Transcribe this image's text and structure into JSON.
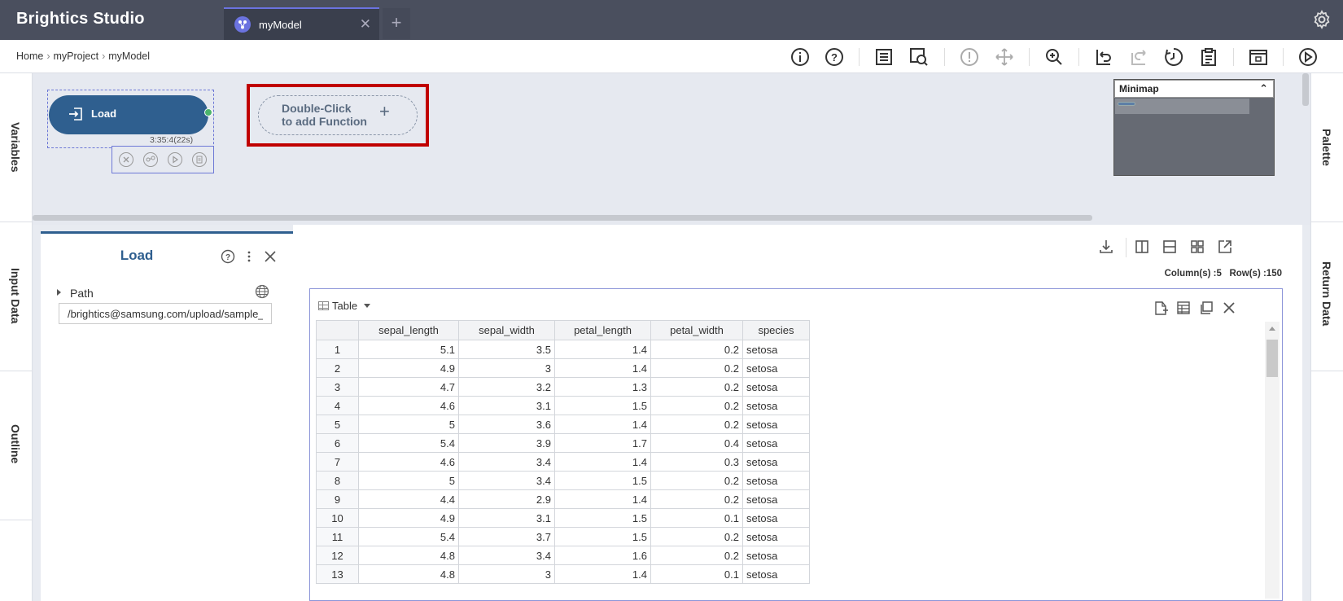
{
  "app": {
    "title": "Brightics Studio"
  },
  "tabs": [
    {
      "label": "myModel"
    }
  ],
  "breadcrumb": {
    "items": [
      "Home",
      "myProject",
      "myModel"
    ]
  },
  "left_rail": {
    "items": [
      "Variables",
      "Input Data",
      "Outline"
    ]
  },
  "right_rail": {
    "items": [
      "Palette",
      "Return Data"
    ]
  },
  "canvas": {
    "node": {
      "label": "Load",
      "time": "3:35:4(22s)"
    },
    "add_function": {
      "line1": "Double-Click",
      "line2": "to add Function",
      "plus": "+"
    },
    "minimap": {
      "title": "Minimap"
    }
  },
  "properties": {
    "title": "Load",
    "path_label": "Path",
    "path_value": "/brightics@samsung.com/upload/sample_iris.csv"
  },
  "result": {
    "counts": "Column(s) :5   Row(s) :150",
    "table_label": "Table",
    "columns": [
      "sepal_length",
      "sepal_width",
      "petal_length",
      "petal_width",
      "species"
    ],
    "rows": [
      [
        "1",
        "5.1",
        "3.5",
        "1.4",
        "0.2",
        "setosa"
      ],
      [
        "2",
        "4.9",
        "3",
        "1.4",
        "0.2",
        "setosa"
      ],
      [
        "3",
        "4.7",
        "3.2",
        "1.3",
        "0.2",
        "setosa"
      ],
      [
        "4",
        "4.6",
        "3.1",
        "1.5",
        "0.2",
        "setosa"
      ],
      [
        "5",
        "5",
        "3.6",
        "1.4",
        "0.2",
        "setosa"
      ],
      [
        "6",
        "5.4",
        "3.9",
        "1.7",
        "0.4",
        "setosa"
      ],
      [
        "7",
        "4.6",
        "3.4",
        "1.4",
        "0.3",
        "setosa"
      ],
      [
        "8",
        "5",
        "3.4",
        "1.5",
        "0.2",
        "setosa"
      ],
      [
        "9",
        "4.4",
        "2.9",
        "1.4",
        "0.2",
        "setosa"
      ],
      [
        "10",
        "4.9",
        "3.1",
        "1.5",
        "0.1",
        "setosa"
      ],
      [
        "11",
        "5.4",
        "3.7",
        "1.5",
        "0.2",
        "setosa"
      ],
      [
        "12",
        "4.8",
        "3.4",
        "1.6",
        "0.2",
        "setosa"
      ],
      [
        "13",
        "4.8",
        "3",
        "1.4",
        "0.1",
        "setosa"
      ]
    ]
  },
  "icons": {
    "toolbar": [
      "info-icon",
      "help-icon",
      "function-list-icon",
      "search-function-icon",
      "validate-icon",
      "move-icon",
      "zoom-icon",
      "undo-icon",
      "redo-icon",
      "history-icon",
      "report-icon",
      "calendar-icon",
      "run-icon"
    ]
  },
  "colors": {
    "header": "#4a4f5e",
    "accent": "#6b73e0",
    "node": "#2f5f8f",
    "highlight": "#c00000"
  }
}
